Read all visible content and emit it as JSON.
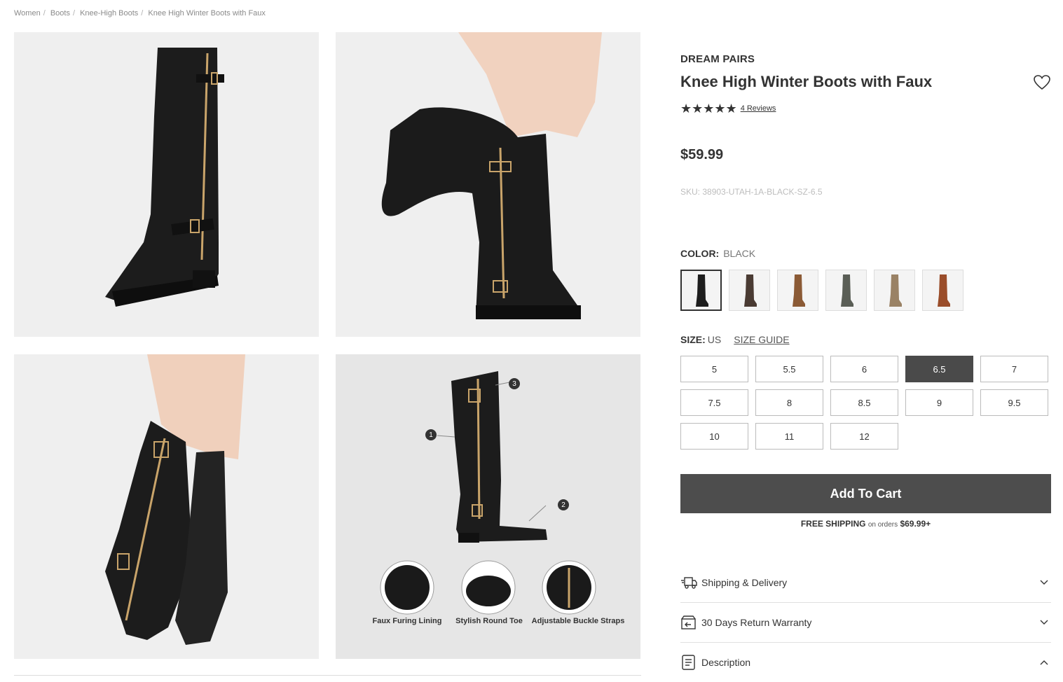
{
  "breadcrumb": [
    "Women",
    "Boots",
    "Knee-High Boots",
    "Knee High Winter Boots with Faux"
  ],
  "product": {
    "brand": "DREAM PAIRS",
    "title": "Knee High Winter Boots with Faux",
    "rating_stars": "★★★★★",
    "rating": 5,
    "reviews_label": "4 Reviews",
    "price": "$59.99",
    "sku": "SKU: 38903-UTAH-1A-BLACK-SZ-6.5"
  },
  "color": {
    "label": "COLOR:",
    "selected": "BLACK",
    "swatches": [
      {
        "name": "black",
        "color": "#1e1e1e"
      },
      {
        "name": "dark-brown",
        "color": "#4a3b33"
      },
      {
        "name": "brown",
        "color": "#8b5a35"
      },
      {
        "name": "olive-gray",
        "color": "#5a5e56"
      },
      {
        "name": "taupe",
        "color": "#9a8265"
      },
      {
        "name": "cognac",
        "color": "#9a4d2a"
      }
    ]
  },
  "size": {
    "label": "SIZE:",
    "unit": "US",
    "guide": "SIZE GUIDE",
    "options": [
      "5",
      "5.5",
      "6",
      "6.5",
      "7",
      "7.5",
      "8",
      "8.5",
      "9",
      "9.5",
      "10",
      "11",
      "12"
    ],
    "selected": "6.5"
  },
  "cart": {
    "button": "Add To Cart",
    "ship_bold": "FREE SHIPPING",
    "ship_mid": "on orders",
    "ship_amount": "$69.99+"
  },
  "accordions": [
    {
      "label": "Shipping & Delivery",
      "icon": "truck-icon",
      "expanded": false
    },
    {
      "label": "30 Days Return Warranty",
      "icon": "return-box-icon",
      "expanded": false
    },
    {
      "label": "Description",
      "icon": "document-icon",
      "expanded": true
    }
  ],
  "features": {
    "callouts": [
      "1",
      "2",
      "3"
    ],
    "labels": [
      "Faux Furing Lining",
      "Stylish Round Toe",
      "Adjustable Buckle Straps"
    ]
  },
  "colors": {
    "text": "#333333",
    "button": "#4d4d4d",
    "sku": "#bdbdbd",
    "image_bg": "#efefef"
  }
}
